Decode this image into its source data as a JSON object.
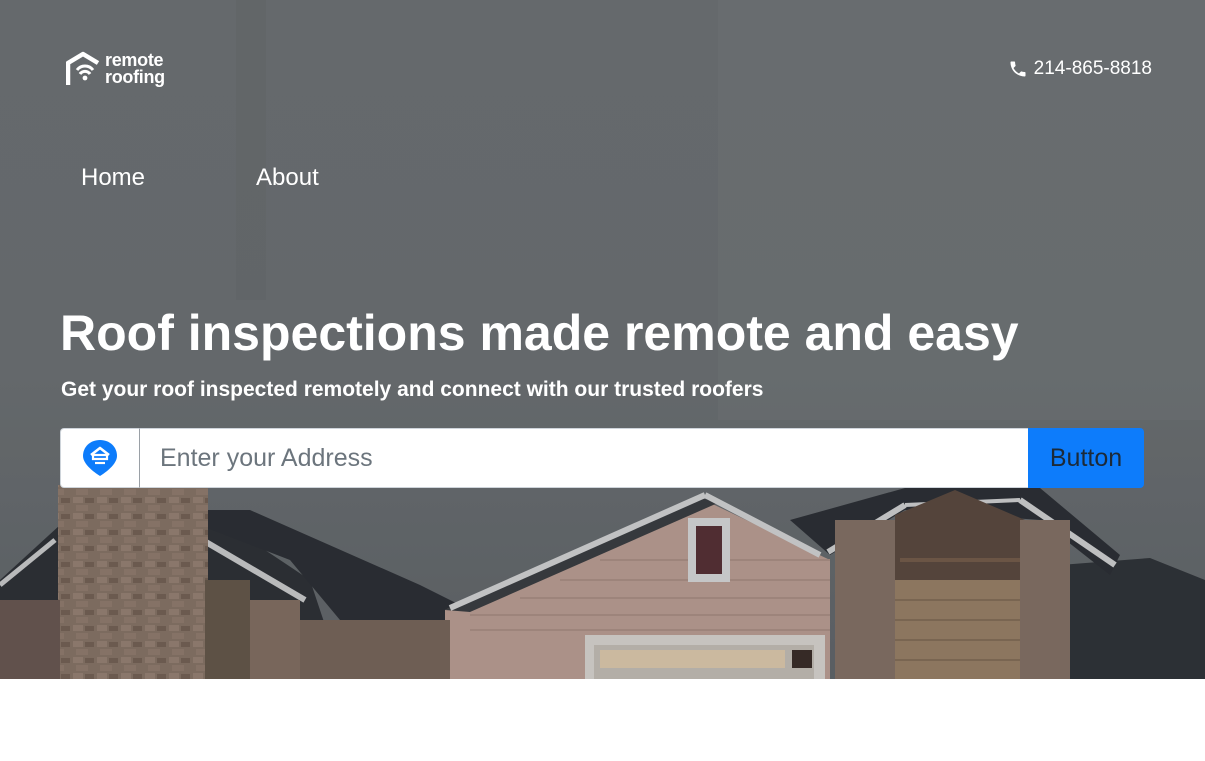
{
  "colors": {
    "accent": "#0d7cfb",
    "hero_overlay": "#737779",
    "text_on_hero": "#ffffff"
  },
  "brand": {
    "line1": "remote",
    "line2": "roofing",
    "icon": "house-wifi-logo-icon"
  },
  "header": {
    "phone": "214-865-8818",
    "phone_icon": "phone-icon"
  },
  "nav": {
    "items": [
      {
        "label": "Home"
      },
      {
        "label": "About"
      }
    ]
  },
  "hero": {
    "title": "Roof inspections made remote and easy",
    "subtitle": "Get your roof inspected remotely and connect with our trusted roofers"
  },
  "search": {
    "icon": "map-pin-house-icon",
    "placeholder": "Enter your Address",
    "value": "",
    "button_label": "Button"
  }
}
